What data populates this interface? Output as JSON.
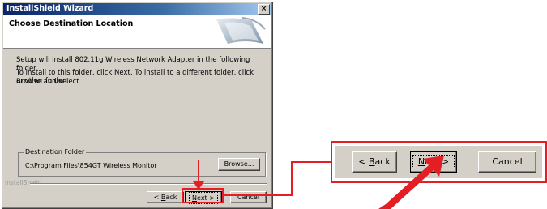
{
  "window": {
    "title": "InstallShield Wizard",
    "close_glyph": "×",
    "header_title": "Choose Destination Location"
  },
  "content": {
    "line1": "Setup will install 802.11g Wireless Network Adapter in the following folder.",
    "line2": "To install to this folder, click Next. To install to a different folder, click Browse and select",
    "line3": "another folder."
  },
  "destination": {
    "legend": "Destination Folder",
    "path": "C:\\Program Files\\854GT Wireless Monitor",
    "browse_label": "Browse..."
  },
  "footer": {
    "brand": "InstallShield",
    "back_prefix": "< ",
    "back_key": "B",
    "back_rest": "ack",
    "next_key": "N",
    "next_rest": "ext >",
    "cancel_label": "Cancel"
  },
  "zoom": {
    "back_prefix": "< ",
    "back_key": "B",
    "back_rest": "ack",
    "next_key": "N",
    "next_rest": "ext >",
    "cancel_label": "Cancel"
  },
  "colors": {
    "highlight": "#e31e24",
    "title_bar": "#0a246a",
    "dialog_face": "#d4d0c8"
  }
}
